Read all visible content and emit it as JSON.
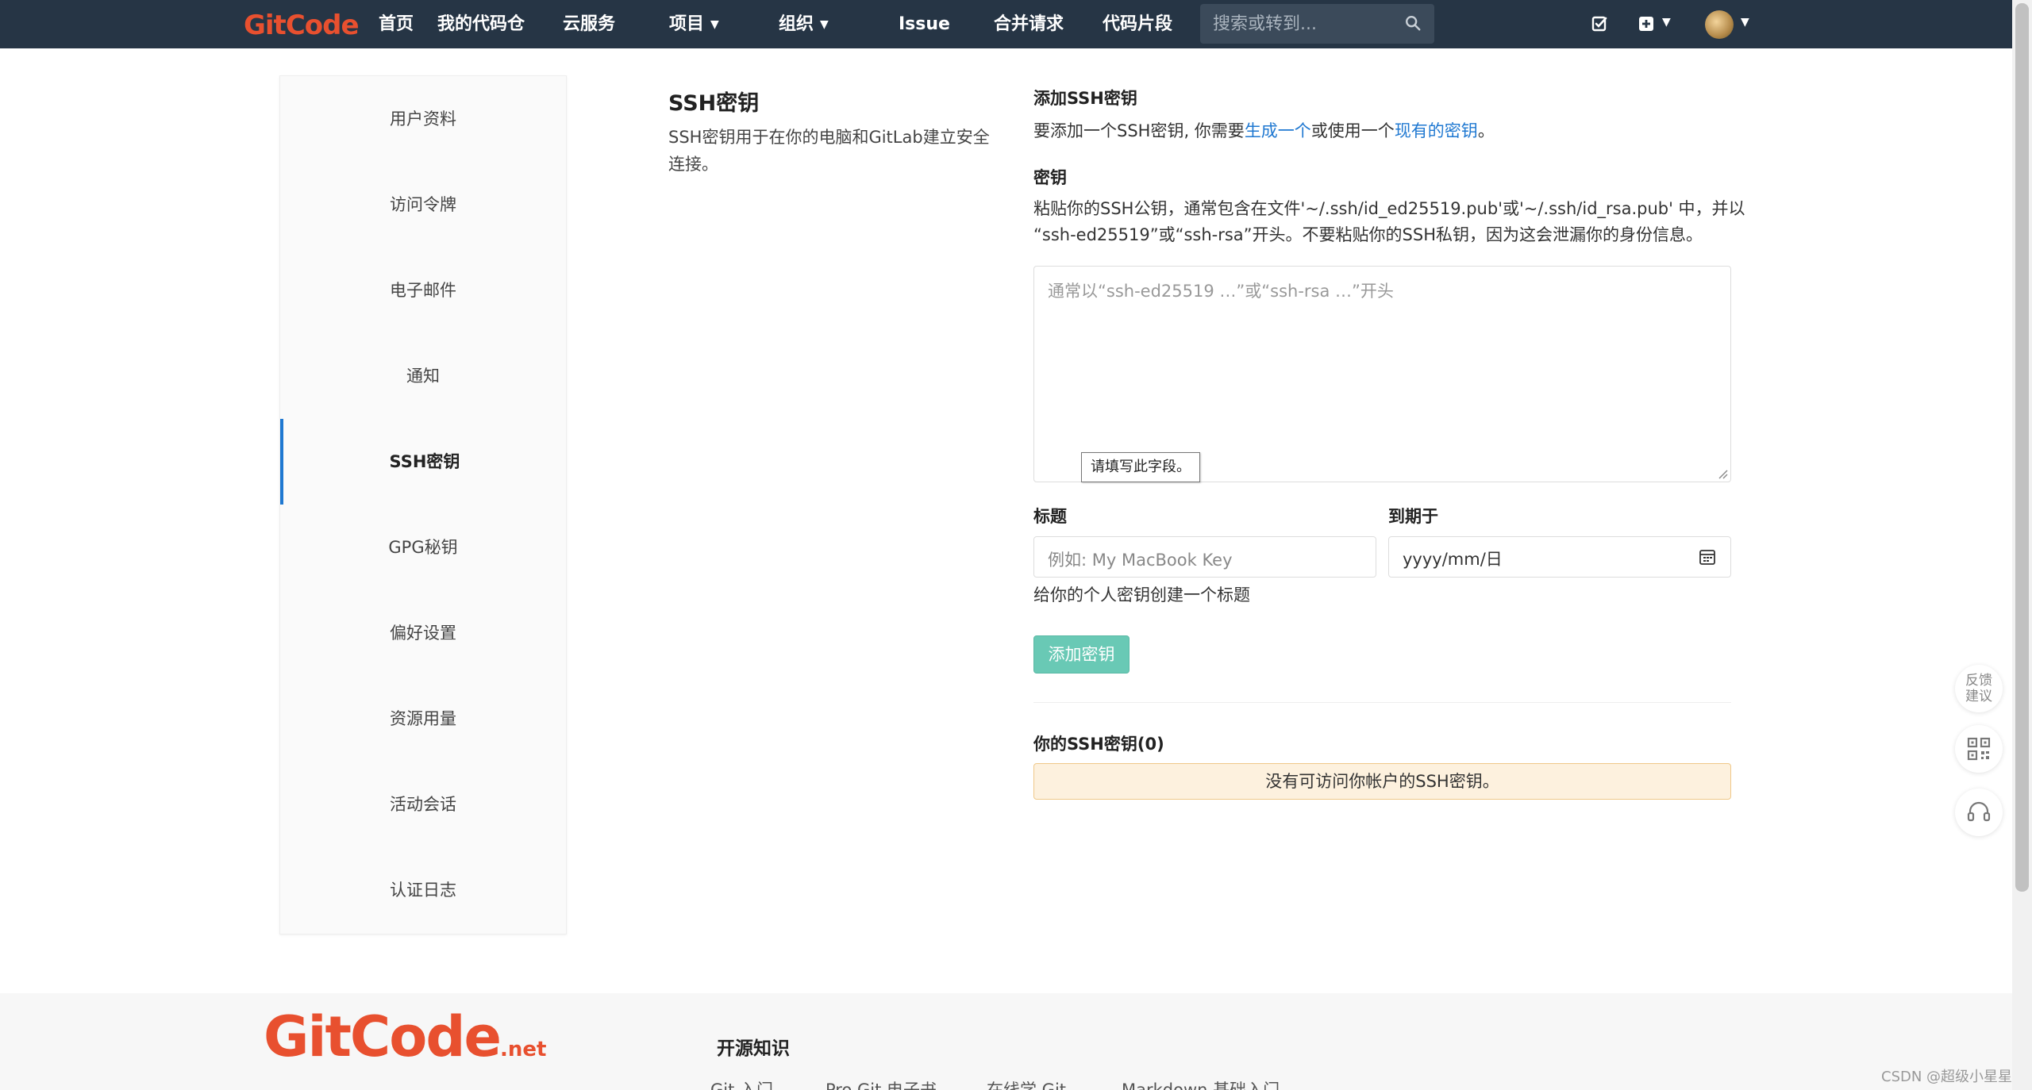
{
  "brand": {
    "logo_text": "GitCode",
    "footer_logo_text": "GitCode",
    "footer_logo_suffix": ".net",
    "color": "#e8502f"
  },
  "nav": {
    "items": [
      {
        "label": "首页"
      },
      {
        "label": "我的代码仓"
      },
      {
        "label": "云服务"
      },
      {
        "label": "项目"
      },
      {
        "label": "组织"
      },
      {
        "label": "Issue"
      },
      {
        "label": "合并请求"
      },
      {
        "label": "代码片段"
      }
    ],
    "search_placeholder": "搜索或转到..."
  },
  "sidebar": {
    "items": [
      {
        "label": "用户资料"
      },
      {
        "label": "访问令牌"
      },
      {
        "label": "电子邮件"
      },
      {
        "label": "通知"
      },
      {
        "label": "SSH密钥",
        "active": true
      },
      {
        "label": "GPG秘钥"
      },
      {
        "label": "偏好设置"
      },
      {
        "label": "资源用量"
      },
      {
        "label": "活动会话"
      },
      {
        "label": "认证日志"
      }
    ]
  },
  "section": {
    "title": "SSH密钥",
    "description": "SSH密钥用于在你的电脑和GitLab建立安全连接。"
  },
  "form": {
    "heading": "添加SSH密钥",
    "intro_pre": "要添加一个SSH密钥, 你需要",
    "intro_link1": "生成一个",
    "intro_mid": "或使用一个",
    "intro_link2": "现有的密钥",
    "intro_post": "。",
    "key_label": "密钥",
    "key_help_line1": "粘贴你的SSH公钥，通常包含在文件'~/.ssh/id_ed25519.pub'或'~/.ssh/id_rsa.pub' 中，并以",
    "key_help_line2": "“ssh-ed25519”或“ssh-rsa”开头。不要粘贴你的SSH私钥，因为这会泄漏你的身份信息。",
    "key_placeholder": "通常以“ssh-ed25519 …”或“ssh-rsa …”开头",
    "validation_tooltip": "请填写此字段。",
    "title_label": "标题",
    "title_placeholder": "例如: My MacBook Key",
    "title_help": "给你的个人密钥创建一个标题",
    "expires_label": "到期于",
    "expires_value": "yyyy/mm/日",
    "submit_label": "添加密钥"
  },
  "keys_list": {
    "heading": "你的SSH密钥(0)",
    "empty_message": "没有可访问你帐户的SSH密钥。"
  },
  "float_widgets": {
    "feedback_line1": "反馈",
    "feedback_line2": "建议"
  },
  "footer": {
    "section_title": "开源知识",
    "links": [
      {
        "label": "Git 入门"
      },
      {
        "label": "Pro Git 电子书"
      },
      {
        "label": "在线学 Git"
      },
      {
        "label": "Markdown 基础入门"
      }
    ]
  },
  "watermark": "CSDN @超级小星星"
}
